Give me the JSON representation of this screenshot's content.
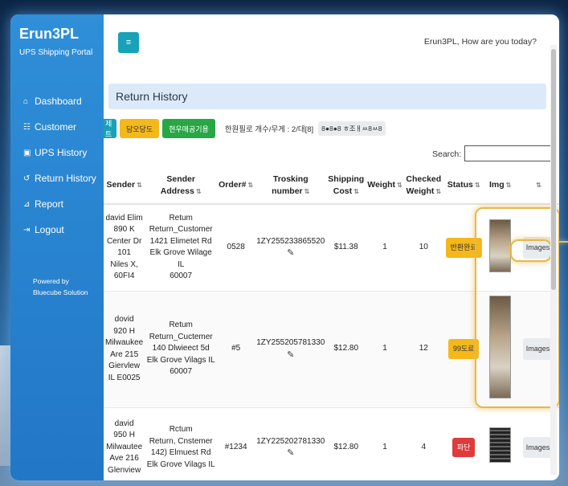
{
  "app": {
    "brand": "Erun3PL",
    "subtitle": "UPS Shipping Portal",
    "powered_line1": "Powered by",
    "powered_line2": "Bluecube Solution"
  },
  "sidebar": {
    "items": [
      {
        "label": "Dashboard",
        "icon": "home-icon"
      },
      {
        "label": "Customer",
        "icon": "users-icon"
      },
      {
        "label": "UPS History",
        "icon": "box-icon"
      },
      {
        "label": "Return History",
        "icon": "return-icon"
      },
      {
        "label": "Report",
        "icon": "chart-icon"
      },
      {
        "label": "Logout",
        "icon": "logout-icon"
      }
    ]
  },
  "header": {
    "menu_icon": "≡",
    "greeting": "Erun3PL, How are you today?"
  },
  "page": {
    "title": "Return History"
  },
  "actions": {
    "teal_label": "제트",
    "yellow_label": "담오당도",
    "green_label": "현우매공기용",
    "summary": "한원필로 개수/무게 : 2/대[8]",
    "summary_badge": "8●8●8 ㅎ조ㅐㅆ8ㅆ8"
  },
  "search": {
    "label": "Search:",
    "value": ""
  },
  "table": {
    "columns": [
      "Sender",
      "Sender Address",
      "Order#",
      "Trosking number",
      "Shipping Cost",
      "Weight",
      "Checked Weight",
      "Status",
      "Img",
      ""
    ],
    "rows": [
      {
        "sender": [
          "david Elim",
          "890 K",
          "Center Dr",
          "101",
          "Niles X,",
          "60FI4"
        ],
        "address": [
          "Retum",
          "Return_Customer",
          "1421 Elimetet Rd",
          "Elk Grove Wilage IL",
          "60007"
        ],
        "order": "0528",
        "tracking": "1ZY255233865520",
        "cost": "$11.38",
        "weight": "1",
        "checked": "10",
        "status": "반환완료",
        "status_color": "#f5b81b",
        "img_button": "Images"
      },
      {
        "sender": [
          "dovid",
          "920 H",
          "Milwaukee",
          "Are 215",
          "Giervlew",
          "IL E0025"
        ],
        "address": [
          "Retum",
          "Return_Cuctemer",
          "140 Dlwieect 5d",
          "Elk Grove Vilags IL",
          "60007"
        ],
        "order": "#5",
        "tracking": "1ZY255205781330",
        "cost": "$12.80",
        "weight": "1",
        "checked": "12",
        "status": "99도료",
        "status_color": "#f5b81b",
        "img_button": "Images"
      },
      {
        "sender": [
          "david",
          "950 H",
          "Milwautee",
          "Ave 216",
          "Glenview"
        ],
        "address": [
          "Rctum",
          "Return, Cnstemer",
          "142) Elmuest Rd",
          "Elk Grove Vilags IL"
        ],
        "order": "#1234",
        "tracking": "1ZY225202781330",
        "cost": "$12.80",
        "weight": "1",
        "checked": "4",
        "status": "파단",
        "status_color": "#e03a3a",
        "img_button": "Images"
      }
    ]
  }
}
